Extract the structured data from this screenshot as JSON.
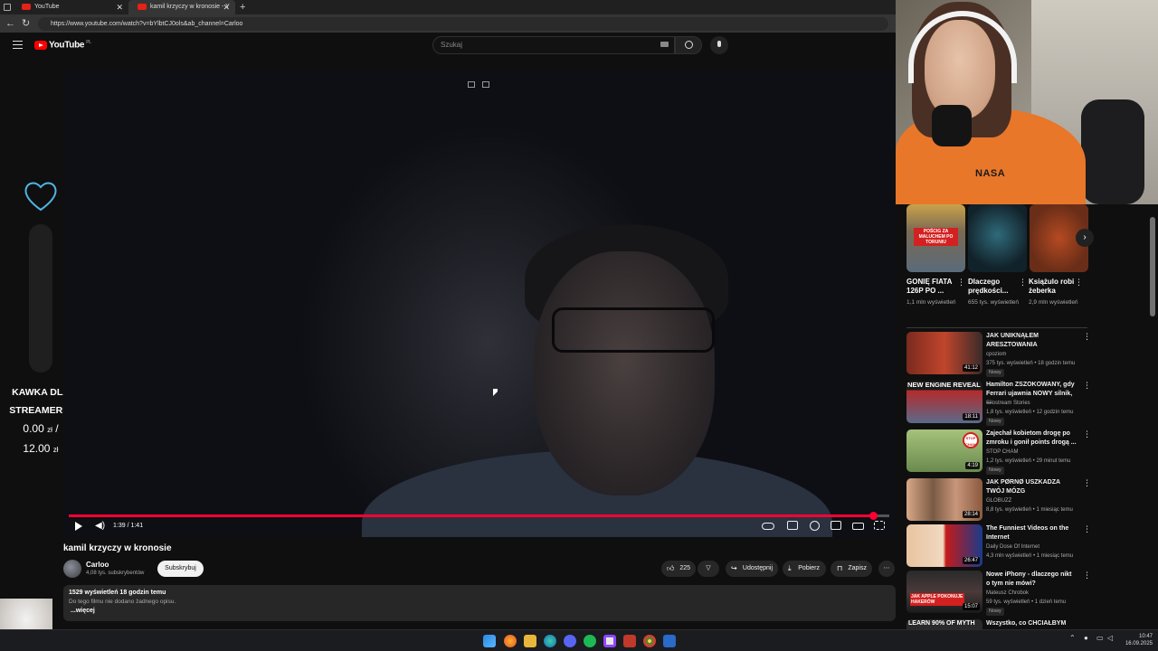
{
  "browser": {
    "tabs": [
      {
        "title": "YouTube"
      },
      {
        "title": "kamil krzyczy w kronosie - Y"
      }
    ],
    "new_tab": "+",
    "url": "https://www.youtube.com/watch?v=bYlbtCJ0ols&ab_channel=Carloo"
  },
  "youtube": {
    "logo": "YouTube",
    "country": "PL",
    "search_placeholder": "Szukaj"
  },
  "overlay": {
    "title_line1": "KAWKA DLA",
    "title_line2": "STREAMERKI",
    "amount_current": "0.00",
    "amount_target": "12.00",
    "currency": "zł",
    "separator": "/",
    "progress_fraction": 0.0
  },
  "player": {
    "time": "1:39 / 1:41",
    "progress_fraction": 0.98
  },
  "video": {
    "title": "kamil krzyczy w kronosie",
    "channel": "Carloo",
    "subscribers": "4,08 tys. subskrybentów",
    "subscribe": "Subskrybuj",
    "likes": "225",
    "share": "Udostępnij",
    "download": "Pobierz",
    "save": "Zapisz",
    "description": {
      "stats": "1529 wyświetleń  18 godzin temu",
      "text": "Do tego filmu nie dodano żadnego opisu.",
      "more": "...więcej"
    }
  },
  "webcam": {
    "shirt_text": "NASA"
  },
  "shorts": [
    {
      "title": "GONIĘ FIATA 126P PO ...",
      "views": "1,1 mln wyświetleń",
      "thumb_text": "POŚCIG ZA MALUCHEM PO TORUNIU"
    },
    {
      "title": "Dlaczego prędkości...",
      "views": "655 tys. wyświetleń",
      "thumb_text": ""
    },
    {
      "title": "Książulo robi żeberka",
      "views": "2,9 mln wyświetleń",
      "thumb_text": ""
    }
  ],
  "recommendations": [
    {
      "title": "JAK UNIKNĄŁEM ARESZTOWANIA",
      "channel": "cpoziom",
      "meta": "375 tys. wyświetleń • 18 godzin temu",
      "badge": "Nowy",
      "duration": "41:12"
    },
    {
      "title": "Hamilton ZSZOKOWANY, gdy Ferrari ujawnia NOWY silnik, ...",
      "channel": "Silostream Stories",
      "meta": "1,8 tys. wyświetleń • 12 godzin temu",
      "badge": "Nowy",
      "duration": "18:11",
      "thumb_text": "NEW ENGINE REVEAL"
    },
    {
      "title": "Zajechał kobietom drogę po zmroku i gonił points drogą ...",
      "channel": "STOP CHAM",
      "meta": "1,2 tys. wyświetleń • 29 minut temu",
      "badge": "Nowy",
      "duration": "4:19",
      "thumb_text": "STOP CHAM"
    },
    {
      "title": "JAK PØRNØ USZKADZA TWÓJ MÓZG",
      "channel": "GLOBUZZ",
      "meta": "8,8 tys. wyświetleń • 1 miesiąc temu",
      "badge": "",
      "duration": "28:14"
    },
    {
      "title": "The Funniest Videos on the Internet",
      "channel": "Daily Dose Of Internet",
      "meta": "4,3 mln wyświetleń • 1 miesiąc temu",
      "badge": "",
      "duration": "26:47"
    },
    {
      "title": "Nowe iPhony - dlaczego nikt o tym nie mówi?",
      "channel": "Mateusz Chrobok",
      "meta": "59 tys. wyświetleń • 1 dzień temu",
      "badge": "Nowy",
      "duration": "15:07",
      "thumb_text": "JAK APPLE POKONUJE HAKERÓW"
    },
    {
      "title": "Wszystko, co CHCIAŁBYM",
      "channel": "",
      "meta": "",
      "badge": "",
      "duration": "",
      "thumb_text": "LEARN 90% OF MYTH"
    }
  ],
  "taskbar": {
    "time": "10:47",
    "date": "16.09.2025"
  },
  "colors": {
    "accent": "#ff0033",
    "background": "#0f0f0f",
    "overlay_heart": "#4fb6e6"
  }
}
